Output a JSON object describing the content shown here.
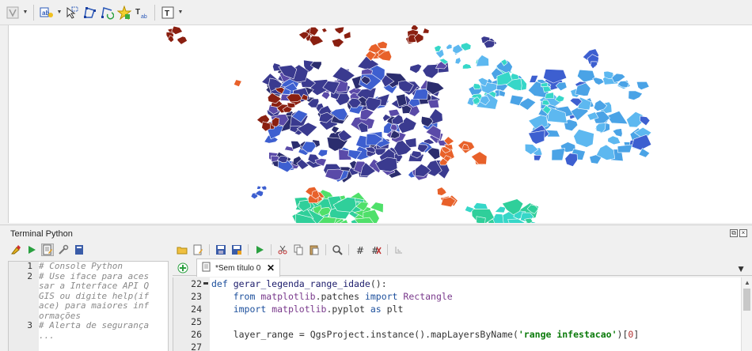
{
  "toolbar": {
    "buttons": [
      "select-features-icon",
      "label-icon",
      "move-label-icon",
      "node-tool-icon",
      "rotate-label-icon",
      "pin-label-icon",
      "change-label-icon",
      "text-annotation-icon"
    ]
  },
  "python_panel": {
    "title": "Terminal Python",
    "console_lines": [
      {
        "num": "1",
        "text": "# Console Python"
      },
      {
        "num": "2",
        "text": "# Use iface para aces"
      },
      {
        "num": "",
        "text": "sar a Interface API Q"
      },
      {
        "num": "",
        "text": "GIS ou digite help(if"
      },
      {
        "num": "",
        "text": "ace) para maiores inf"
      },
      {
        "num": "",
        "text": "ormações"
      },
      {
        "num": "3",
        "text": "# Alerta de segurança"
      },
      {
        "num": "",
        "text": "..."
      }
    ],
    "tab_label": "*Sem título 0",
    "editor_lines": [
      {
        "num": "22",
        "fold": "▬",
        "code": "def gerar_legenda_range_idade():"
      },
      {
        "num": "23",
        "fold": "",
        "code": "    from matplotlib.patches import Rectangle"
      },
      {
        "num": "24",
        "fold": "",
        "code": "    import matplotlib.pyplot as plt"
      },
      {
        "num": "25",
        "fold": "",
        "code": ""
      },
      {
        "num": "26",
        "fold": "",
        "code": "    layer_range = QgsProject.instance().mapLayersByName('range infestacao')[0]"
      },
      {
        "num": "27",
        "fold": "",
        "code": ""
      }
    ]
  },
  "colors": {
    "dark_blue": "#2b2d6e",
    "navy": "#3a3a8f",
    "purple": "#5a4aa8",
    "royal_blue": "#3d5fd0",
    "light_blue": "#4aa3e6",
    "sky_blue": "#5db8f0",
    "cyan": "#36d7c8",
    "teal": "#2fcf9a",
    "green": "#4fe06a",
    "orange": "#e8612a",
    "dark_red": "#8a1f10"
  }
}
